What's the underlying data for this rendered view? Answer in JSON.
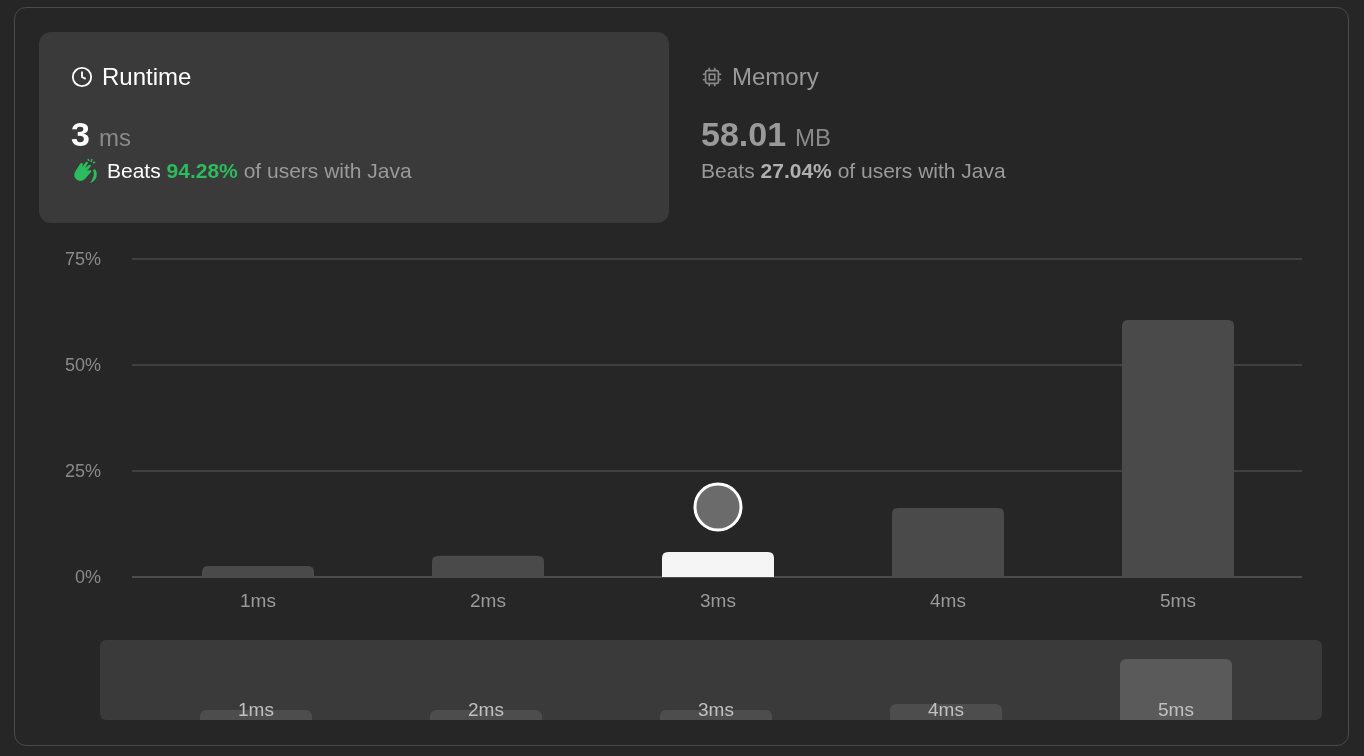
{
  "stats": [
    {
      "kind": "runtime",
      "title": "Runtime",
      "value": "3",
      "unit": "ms",
      "beats": "Beats",
      "percent": "94.28%",
      "suffix": "of users with Java",
      "selected": true
    },
    {
      "kind": "memory",
      "title": "Memory",
      "value": "58.01",
      "unit": "MB",
      "beats": "Beats",
      "percent": "27.04%",
      "suffix": "of users with Java",
      "selected": false
    }
  ],
  "distribution": {
    "chart_data": {
      "type": "bar",
      "categories": [
        "1ms",
        "2ms",
        "3ms",
        "4ms",
        "5ms"
      ],
      "values": [
        2.6,
        5.0,
        5.9,
        16.3,
        60.6
      ],
      "ylim": [
        0,
        75
      ],
      "yticks": [
        {
          "value": 0,
          "label": "0%"
        },
        {
          "value": 25,
          "label": "25%"
        },
        {
          "value": 50,
          "label": "50%"
        },
        {
          "value": 75,
          "label": "75%"
        }
      ]
    },
    "bars": [
      {
        "selected": false
      },
      {
        "selected": false
      },
      {
        "selected": true
      },
      {
        "selected": false
      },
      {
        "selected": false
      }
    ]
  },
  "overview": {
    "labels": [
      "1ms",
      "2ms",
      "3ms",
      "4ms",
      "5ms"
    ]
  }
}
